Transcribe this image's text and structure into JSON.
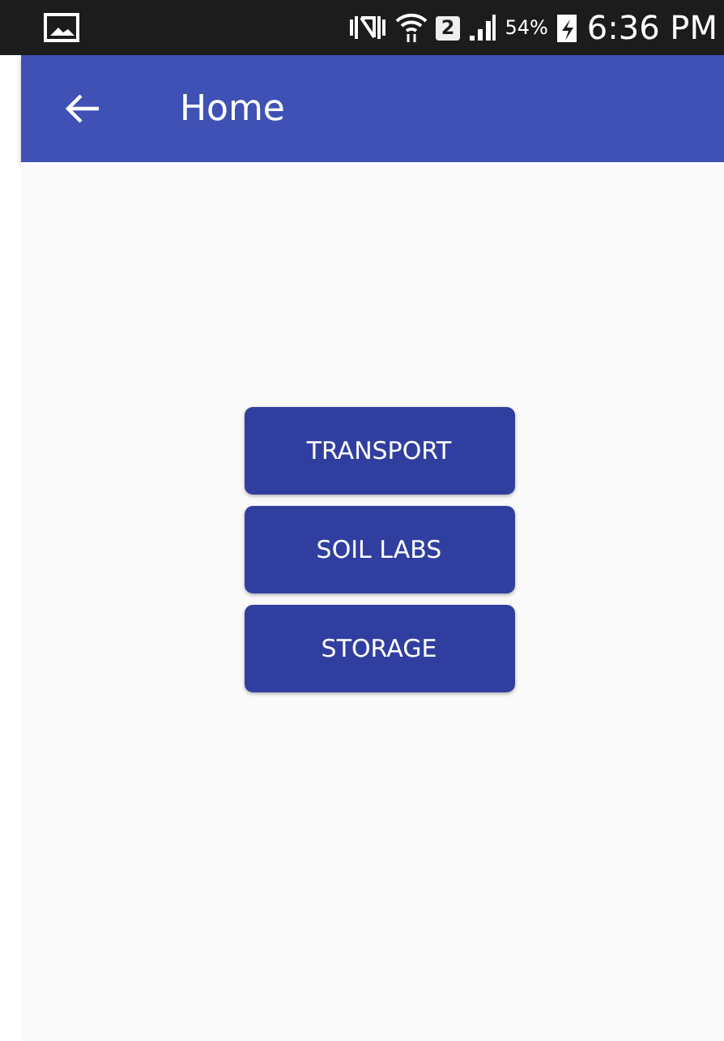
{
  "status_bar": {
    "sim_badge": "2",
    "battery": "54%",
    "time": "6:36 PM"
  },
  "app_bar": {
    "title": "Home"
  },
  "buttons": [
    {
      "label": "TRANSPORT"
    },
    {
      "label": "SOIL LABS"
    },
    {
      "label": "STORAGE"
    }
  ]
}
